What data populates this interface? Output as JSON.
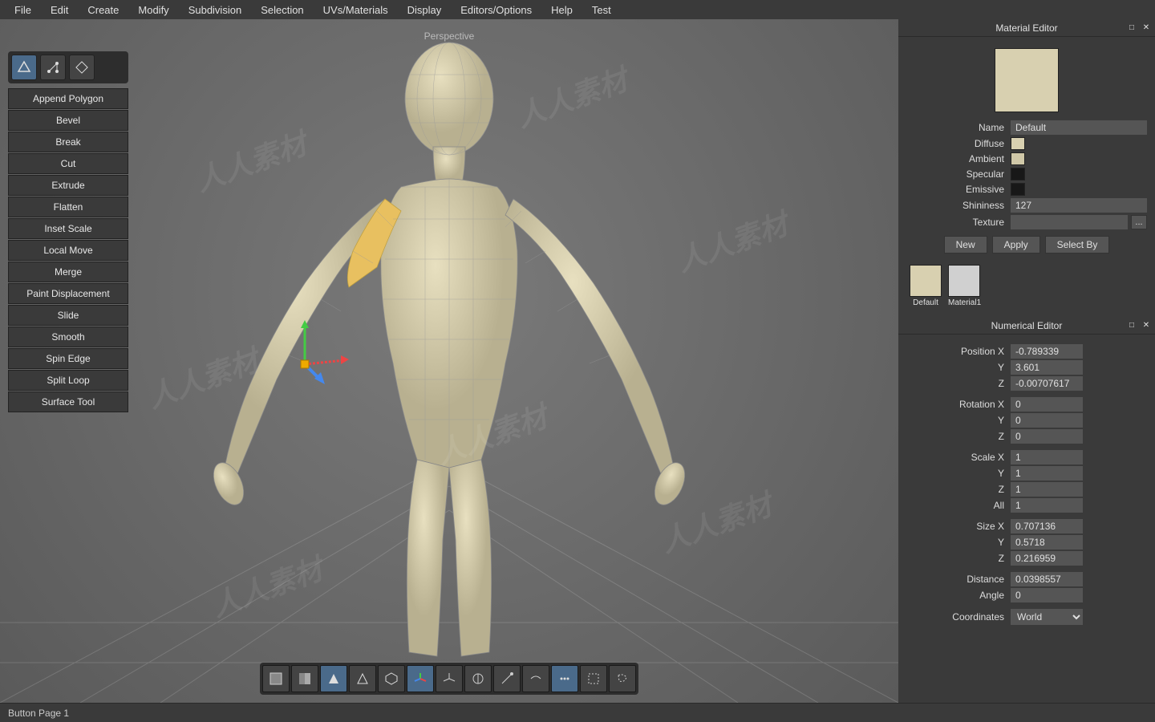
{
  "menu": [
    "File",
    "Edit",
    "Create",
    "Modify",
    "Subdivision",
    "Selection",
    "UVs/Materials",
    "Display",
    "Editors/Options",
    "Help",
    "Test"
  ],
  "viewport": {
    "label": "Perspective"
  },
  "leftTools": [
    "Append Polygon",
    "Bevel",
    "Break",
    "Cut",
    "Extrude",
    "Flatten",
    "Inset Scale",
    "Local Move",
    "Merge",
    "Paint Displacement",
    "Slide",
    "Smooth",
    "Spin Edge",
    "Split Loop",
    "Surface Tool"
  ],
  "materialEditor": {
    "title": "Material Editor",
    "nameLabel": "Name",
    "nameValue": "Default",
    "diffuseLabel": "Diffuse",
    "diffuseColor": "#d8d0b0",
    "ambientLabel": "Ambient",
    "ambientColor": "#d0c8a8",
    "specularLabel": "Specular",
    "specularColor": "#181818",
    "emissiveLabel": "Emissive",
    "emissiveColor": "#181818",
    "shininessLabel": "Shininess",
    "shininessValue": "127",
    "textureLabel": "Texture",
    "textureValue": "",
    "browseBtn": "...",
    "newBtn": "New",
    "applyBtn": "Apply",
    "selectByBtn": "Select By",
    "materials": [
      {
        "name": "Default",
        "color": "#d8d0b0"
      },
      {
        "name": "Material1",
        "color": "#d0d0d0"
      }
    ]
  },
  "numericalEditor": {
    "title": "Numerical Editor",
    "positionLabel": "Position X",
    "posX": "-0.789339",
    "posYLabel": "Y",
    "posY": "3.601",
    "posZLabel": "Z",
    "posZ": "-0.00707617",
    "rotationLabel": "Rotation X",
    "rotX": "0",
    "rotYLabel": "Y",
    "rotY": "0",
    "rotZLabel": "Z",
    "rotZ": "0",
    "scaleLabel": "Scale X",
    "scaleX": "1",
    "scaleYLabel": "Y",
    "scaleY": "1",
    "scaleZLabel": "Z",
    "scaleZ": "1",
    "scaleAllLabel": "All",
    "scaleAll": "1",
    "sizeLabel": "Size X",
    "sizeX": "0.707136",
    "sizeYLabel": "Y",
    "sizeY": "0.5718",
    "sizeZLabel": "Z",
    "sizeZ": "0.216959",
    "distanceLabel": "Distance",
    "distance": "0.0398557",
    "angleLabel": "Angle",
    "angle": "0",
    "coordLabel": "Coordinates",
    "coordValue": "World"
  },
  "statusbar": {
    "text": "Button Page 1"
  },
  "watermark": "人人素材"
}
